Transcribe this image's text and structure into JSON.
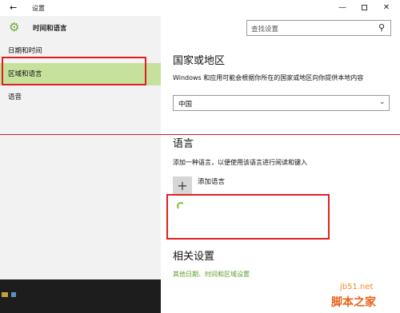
{
  "titlebar": {
    "back_icon": "←",
    "title": "设置",
    "minimize_icon": "—",
    "close_icon": "✕"
  },
  "sidebar": {
    "header_title": "时间和语言",
    "items": [
      {
        "label": "日期和时间"
      },
      {
        "label": "区域和语言"
      },
      {
        "label": "语音"
      }
    ]
  },
  "search": {
    "placeholder": "查找设置",
    "icon": "⚲"
  },
  "country": {
    "heading": "国家或地区",
    "description": "Windows 和应用可能会根据你所在的国家或地区向你提供本地内容",
    "selected": "中国",
    "chevron": "⌄"
  },
  "language": {
    "heading": "语言",
    "description": "添加一种语言，以便使用该语言进行阅读和键入",
    "add_icon": "+",
    "add_label": "添加语言"
  },
  "related": {
    "heading": "相关设置",
    "link": "其他日期、时间和区域设置"
  },
  "watermark": {
    "line1": "jb51.net",
    "line2": "脚本之家"
  },
  "colors": {
    "accent": "#6da53d",
    "selected_bg": "#c5e19c",
    "annotation": "#e02020"
  }
}
